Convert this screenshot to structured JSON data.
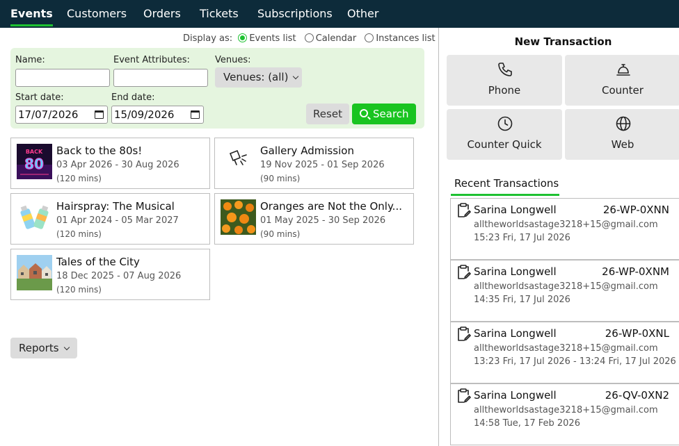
{
  "nav": {
    "tabs": [
      {
        "label": "Events",
        "active": true
      },
      {
        "label": "Customers"
      },
      {
        "label": "Orders"
      },
      {
        "label": "Tickets"
      },
      {
        "label": "Subscriptions"
      },
      {
        "label": "Other"
      }
    ]
  },
  "display_as": {
    "label": "Display as:",
    "options": [
      "Events list",
      "Calendar",
      "Instances list"
    ],
    "selected": "Events list"
  },
  "filters": {
    "name_label": "Name:",
    "name_value": "",
    "attributes_label": "Event Attributes:",
    "attributes_value": "",
    "venues_label": "Venues:",
    "venues_value": "Venues: (all)",
    "start_label": "Start date:",
    "start_value": "17/07/2026",
    "end_label": "End date:",
    "end_value": "15/09/2026",
    "reset_label": "Reset",
    "search_label": "Search"
  },
  "events": [
    {
      "name": "Back to the 80s!",
      "dates": "03 Apr 2026 - 30 Aug 2026",
      "duration": "(120 mins)",
      "thumb": "retro-80s-image"
    },
    {
      "name": "Gallery Admission",
      "dates": "19 Nov 2025 - 01 Sep 2026",
      "duration": "(90 mins)",
      "thumb": "spotlight-icon"
    },
    {
      "name": "Hairspray: The Musical",
      "dates": "01 Apr 2024 - 05 Mar 2027",
      "duration": "(120 mins)",
      "thumb": "hairspray-cans-image"
    },
    {
      "name": "Oranges are Not the Only...",
      "dates": "01 May 2025 - 30 Sep 2026",
      "duration": "(90 mins)",
      "thumb": "oranges-image"
    },
    {
      "name": "Tales of the City",
      "dates": "18 Dec 2025 - 07 Aug 2026",
      "duration": "(120 mins)",
      "thumb": "city-houses-image"
    }
  ],
  "reports_label": "Reports",
  "new_transaction": {
    "title": "New Transaction",
    "buttons": [
      {
        "label": "Phone",
        "icon": "phone-icon"
      },
      {
        "label": "Counter",
        "icon": "bell-icon"
      },
      {
        "label": "Counter Quick",
        "icon": "clock-icon"
      },
      {
        "label": "Web",
        "icon": "globe-icon"
      }
    ]
  },
  "recent": {
    "tab_label": "Recent Transactions",
    "items": [
      {
        "name": "Sarina Longwell",
        "ref": "26-WP-0XNN",
        "email": "alltheworldsastage3218+15@gmail.com",
        "time": "15:23 Fri, 17 Jul 2026"
      },
      {
        "name": "Sarina Longwell",
        "ref": "26-WP-0XNM",
        "email": "alltheworldsastage3218+15@gmail.com",
        "time": "14:35 Fri, 17 Jul 2026"
      },
      {
        "name": "Sarina Longwell",
        "ref": "26-WP-0XNL",
        "email": "alltheworldsastage3218+15@gmail.com",
        "time": "13:23 Fri, 17 Jul 2026 - 13:24 Fri, 17 Jul 2026"
      },
      {
        "name": "Sarina Longwell",
        "ref": "26-QV-0XN2",
        "email": "alltheworldsastage3218+15@gmail.com",
        "time": "14:58 Tue, 17 Feb 2026"
      }
    ]
  },
  "colors": {
    "nav_bg": "#0d2b3a",
    "accent_green": "#1ec131",
    "filter_bg": "#e5f5df",
    "button_grey": "#dcdcdc"
  }
}
